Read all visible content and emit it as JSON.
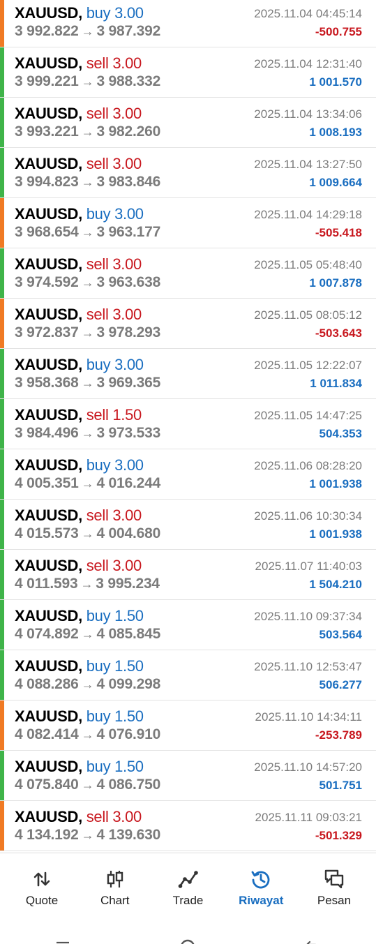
{
  "trades": [
    {
      "symbol": "XAUUSD,",
      "side": "buy 3.00",
      "side_type": "buy",
      "open": "3 992.822",
      "close": "3 987.392",
      "time": "2025.11.04 04:45:14",
      "profit": "-500.755",
      "result": "loss"
    },
    {
      "symbol": "XAUUSD,",
      "side": "sell 3.00",
      "side_type": "sell",
      "open": "3 999.221",
      "close": "3 988.332",
      "time": "2025.11.04 12:31:40",
      "profit": "1 001.570",
      "result": "win"
    },
    {
      "symbol": "XAUUSD,",
      "side": "sell 3.00",
      "side_type": "sell",
      "open": "3 993.221",
      "close": "3 982.260",
      "time": "2025.11.04 13:34:06",
      "profit": "1 008.193",
      "result": "win"
    },
    {
      "symbol": "XAUUSD,",
      "side": "sell 3.00",
      "side_type": "sell",
      "open": "3 994.823",
      "close": "3 983.846",
      "time": "2025.11.04 13:27:50",
      "profit": "1 009.664",
      "result": "win"
    },
    {
      "symbol": "XAUUSD,",
      "side": "buy 3.00",
      "side_type": "buy",
      "open": "3 968.654",
      "close": "3 963.177",
      "time": "2025.11.04 14:29:18",
      "profit": "-505.418",
      "result": "loss"
    },
    {
      "symbol": "XAUUSD,",
      "side": "sell 3.00",
      "side_type": "sell",
      "open": "3 974.592",
      "close": "3 963.638",
      "time": "2025.11.05 05:48:40",
      "profit": "1 007.878",
      "result": "win"
    },
    {
      "symbol": "XAUUSD,",
      "side": "sell 3.00",
      "side_type": "sell",
      "open": "3 972.837",
      "close": "3 978.293",
      "time": "2025.11.05 08:05:12",
      "profit": "-503.643",
      "result": "loss"
    },
    {
      "symbol": "XAUUSD,",
      "side": "buy 3.00",
      "side_type": "buy",
      "open": "3 958.368",
      "close": "3 969.365",
      "time": "2025.11.05 12:22:07",
      "profit": "1 011.834",
      "result": "win"
    },
    {
      "symbol": "XAUUSD,",
      "side": "sell 1.50",
      "side_type": "sell",
      "open": "3 984.496",
      "close": "3 973.533",
      "time": "2025.11.05 14:47:25",
      "profit": "504.353",
      "result": "win"
    },
    {
      "symbol": "XAUUSD,",
      "side": "buy 3.00",
      "side_type": "buy",
      "open": "4 005.351",
      "close": "4 016.244",
      "time": "2025.11.06 08:28:20",
      "profit": "1 001.938",
      "result": "win"
    },
    {
      "symbol": "XAUUSD,",
      "side": "sell 3.00",
      "side_type": "sell",
      "open": "4 015.573",
      "close": "4 004.680",
      "time": "2025.11.06 10:30:34",
      "profit": "1 001.938",
      "result": "win"
    },
    {
      "symbol": "XAUUSD,",
      "side": "sell 3.00",
      "side_type": "sell",
      "open": "4 011.593",
      "close": "3 995.234",
      "time": "2025.11.07 11:40:03",
      "profit": "1 504.210",
      "result": "win"
    },
    {
      "symbol": "XAUUSD,",
      "side": "buy 1.50",
      "side_type": "buy",
      "open": "4 074.892",
      "close": "4 085.845",
      "time": "2025.11.10 09:37:34",
      "profit": "503.564",
      "result": "win"
    },
    {
      "symbol": "XAUUSD,",
      "side": "buy 1.50",
      "side_type": "buy",
      "open": "4 088.286",
      "close": "4 099.298",
      "time": "2025.11.10 12:53:47",
      "profit": "506.277",
      "result": "win"
    },
    {
      "symbol": "XAUUSD,",
      "side": "buy 1.50",
      "side_type": "buy",
      "open": "4 082.414",
      "close": "4 076.910",
      "time": "2025.11.10 14:34:11",
      "profit": "-253.789",
      "result": "loss"
    },
    {
      "symbol": "XAUUSD,",
      "side": "buy 1.50",
      "side_type": "buy",
      "open": "4 075.840",
      "close": "4 086.750",
      "time": "2025.11.10 14:57:20",
      "profit": "501.751",
      "result": "win"
    },
    {
      "symbol": "XAUUSD,",
      "side": "sell 3.00",
      "side_type": "sell",
      "open": "4 134.192",
      "close": "4 139.630",
      "time": "2025.11.11 09:03:21",
      "profit": "-501.329",
      "result": "loss"
    }
  ],
  "arrow": "→",
  "tabs": [
    {
      "label": "Quote",
      "icon": "quote-arrows-icon"
    },
    {
      "label": "Chart",
      "icon": "candlestick-chart-icon"
    },
    {
      "label": "Trade",
      "icon": "trade-line-icon"
    },
    {
      "label": "Riwayat",
      "icon": "history-clock-icon",
      "active": true
    },
    {
      "label": "Pesan",
      "icon": "messages-icon"
    }
  ],
  "colors": {
    "buy": "#1a6ec0",
    "sell": "#c8181f",
    "win_bar": "#3fb449",
    "loss_bar": "#f07a24",
    "active_tab": "#1a6ec0"
  }
}
